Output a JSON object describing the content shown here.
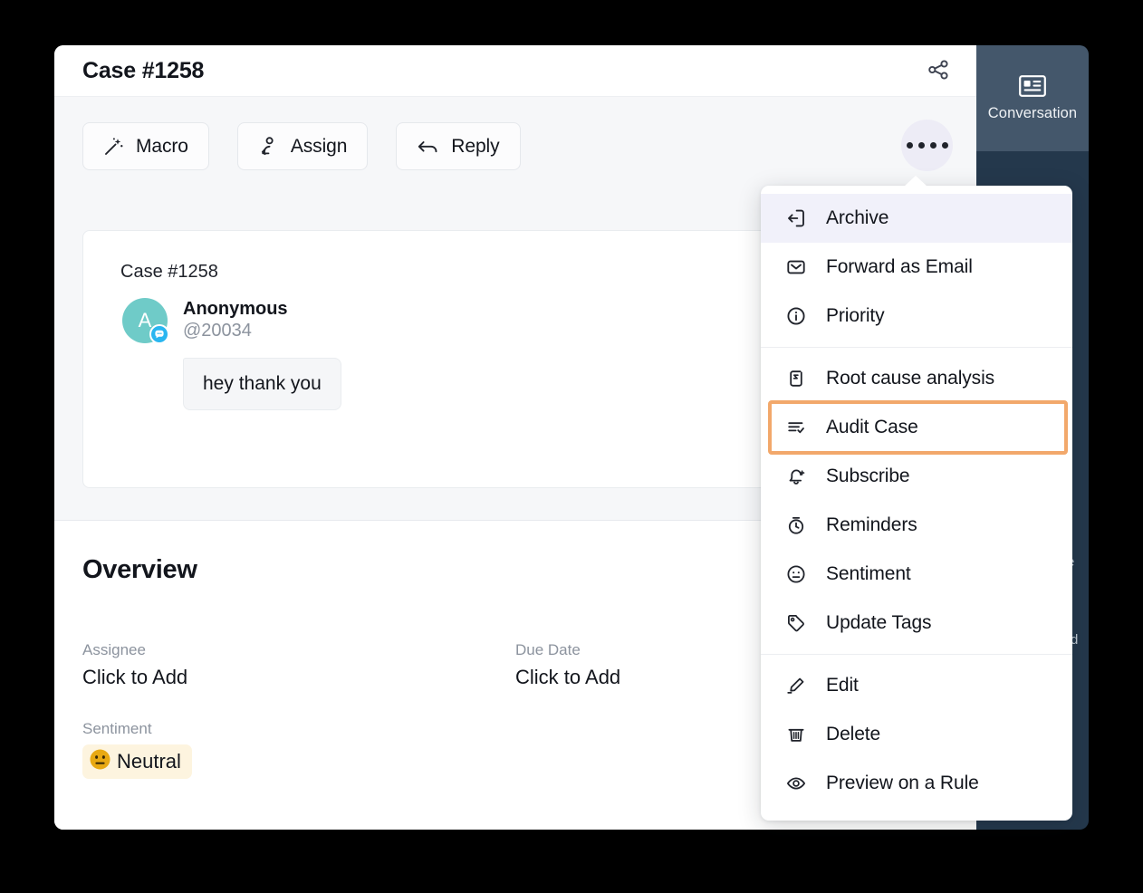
{
  "header": {
    "case_title": "Case #1258",
    "share_icon": "share-icon"
  },
  "toolbar": {
    "buttons": [
      {
        "label": "Macro",
        "icon": "magic-wand-icon"
      },
      {
        "label": "Assign",
        "icon": "person-assign-icon"
      },
      {
        "label": "Reply",
        "icon": "reply-arrow-icon"
      }
    ],
    "more_button": "more-options-icon"
  },
  "conversation": {
    "case_id": "Case #1258",
    "sender_name": "Anonymous",
    "sender_handle": "@20034",
    "avatar_initial": "A",
    "avatar_color": "#6fcbc8",
    "avatar_badge_icon": "chat-bubble-icon",
    "message": "hey thank you"
  },
  "overview": {
    "title": "Overview",
    "assignee_label": "Assignee",
    "assignee_value": "Click to Add",
    "due_date_label": "Due Date",
    "due_date_value": "Click to Add",
    "sentiment_label": "Sentiment",
    "sentiment_value": "Neutral",
    "sentiment_emoji": "neutral-face-icon",
    "sentiment_chip_color": "#fdf4df"
  },
  "menu": {
    "items": [
      {
        "label": "Archive",
        "icon": "archive-exit-icon",
        "state": "active"
      },
      {
        "label": "Forward as Email",
        "icon": "envelope-icon",
        "state": "normal"
      },
      {
        "label": "Priority",
        "icon": "info-circle-icon",
        "state": "normal"
      },
      {
        "label": "Root cause analysis",
        "icon": "root-cause-icon",
        "state": "normal"
      },
      {
        "label": "Audit Case",
        "icon": "audit-list-icon",
        "state": "highlight"
      },
      {
        "label": "Subscribe",
        "icon": "bell-plus-icon",
        "state": "normal"
      },
      {
        "label": "Reminders",
        "icon": "stopwatch-icon",
        "state": "normal"
      },
      {
        "label": "Sentiment",
        "icon": "neutral-face-icon",
        "state": "normal"
      },
      {
        "label": "Update Tags",
        "icon": "tag-icon",
        "state": "normal"
      },
      {
        "label": "Edit",
        "icon": "pencil-icon",
        "state": "normal"
      },
      {
        "label": "Delete",
        "icon": "trash-icon",
        "state": "normal"
      },
      {
        "label": "Preview on a Rule",
        "icon": "eye-icon",
        "state": "normal"
      }
    ],
    "highlight_color": "#f2a86b",
    "active_color": "#f1f1fa"
  },
  "right_panel": {
    "tab_label": "Conversation",
    "tab_icon": "card-list-icon",
    "panel_color": "#24384c",
    "tab_color": "#44576b"
  }
}
